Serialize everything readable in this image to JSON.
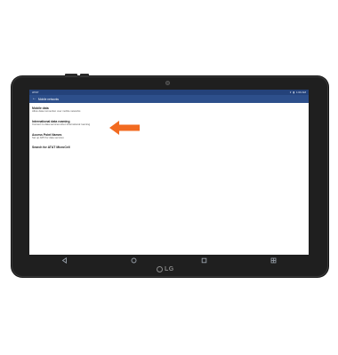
{
  "status_bar": {
    "carrier": "AT&T",
    "time": "1:00 AM"
  },
  "app_bar": {
    "title": "Mobile networks"
  },
  "settings": [
    {
      "title": "Mobile data",
      "subtitle": "Allow data connection over mobile networks"
    },
    {
      "title": "International data roaming",
      "subtitle": "Connect to data services when international roaming"
    },
    {
      "title": "Access Point Names",
      "subtitle": "Set up APN for data services"
    },
    {
      "title": "Search for AT&T MicroCell",
      "subtitle": ""
    }
  ],
  "nav_bar": {
    "icons": [
      "back-icon",
      "home-icon",
      "recents-icon",
      "dual-window-icon"
    ]
  },
  "device": {
    "brand": "LG"
  },
  "colors": {
    "status_bar": "#24427a",
    "app_bar": "#2d4f8b",
    "arrow": "#f26b21"
  }
}
